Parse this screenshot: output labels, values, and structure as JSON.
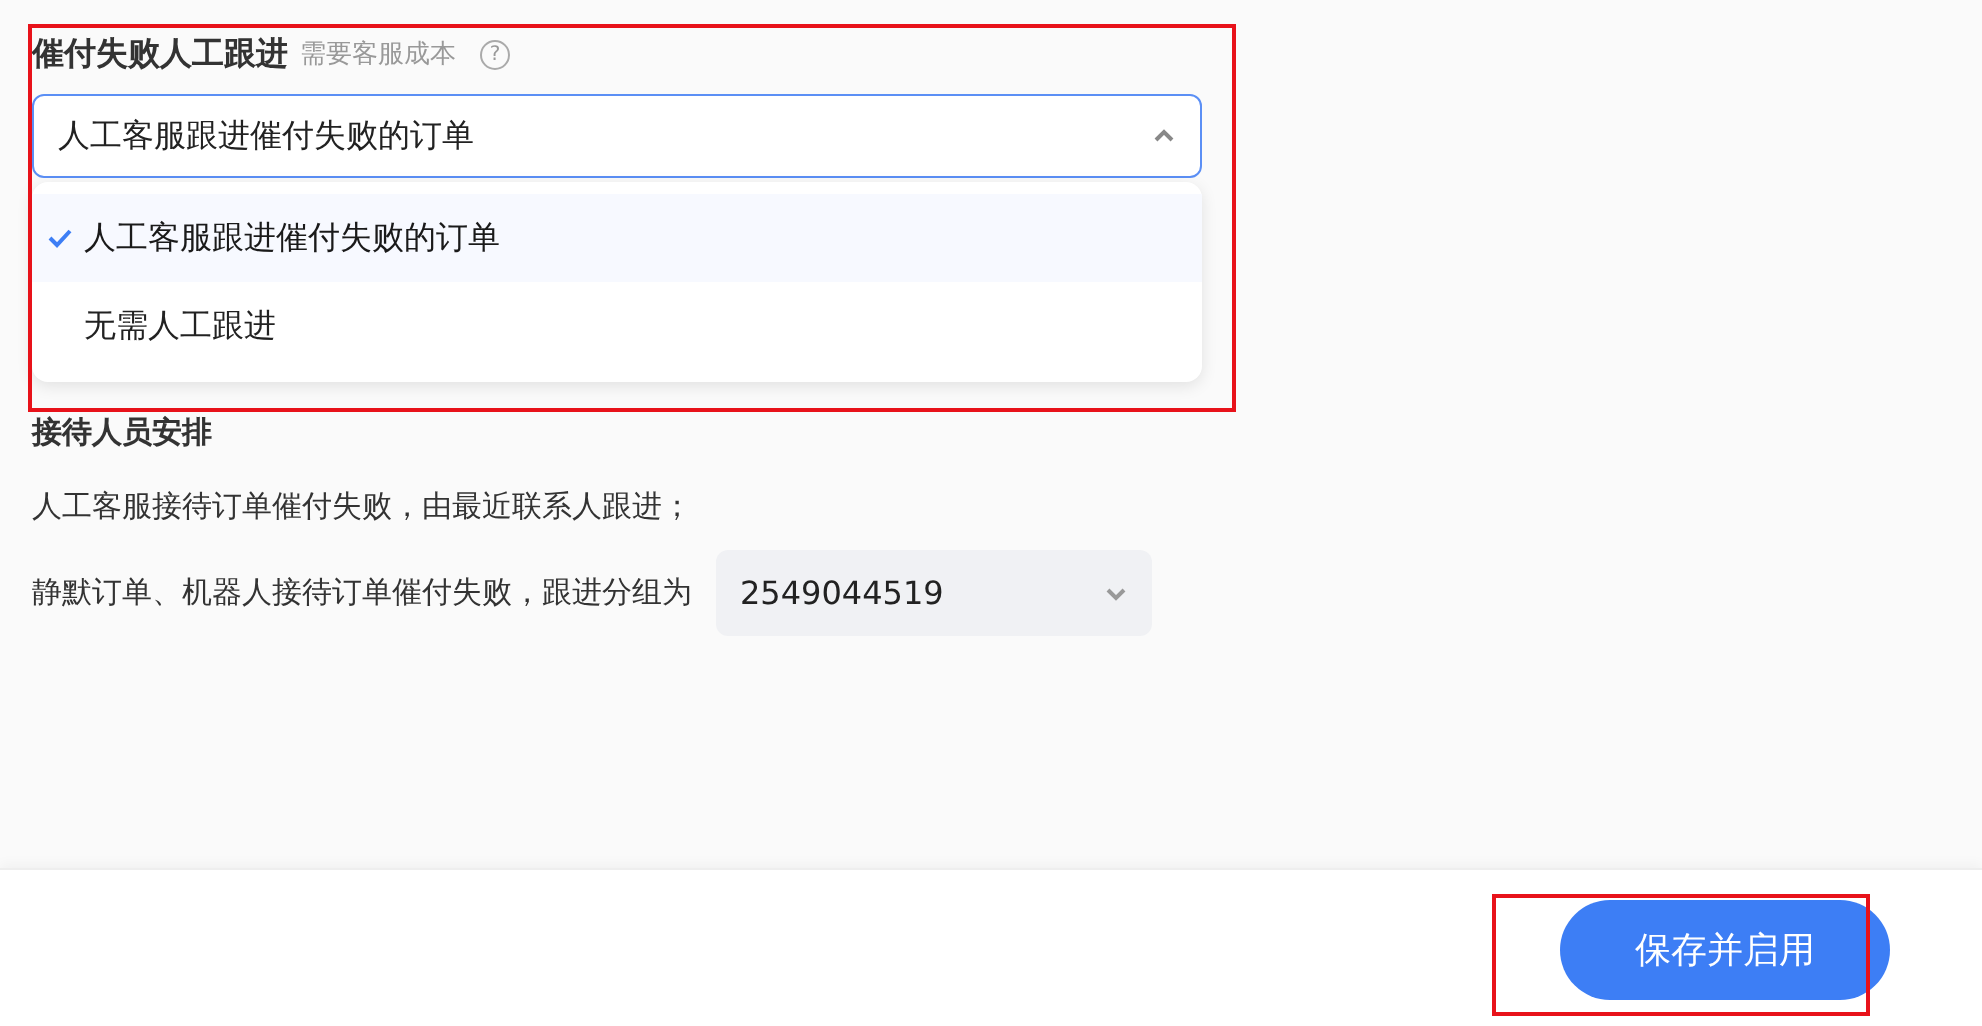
{
  "section": {
    "title": "催付失败人工跟进",
    "hint": "需要客服成本",
    "help_icon": "?"
  },
  "select": {
    "value": "人工客服跟进催付失败的订单",
    "expanded": true,
    "options": [
      {
        "label": "人工客服跟进催付失败的订单",
        "selected": true
      },
      {
        "label": "无需人工跟进",
        "selected": false
      }
    ]
  },
  "reception": {
    "title": "接待人员安排",
    "line": "人工客服接待订单催付失败，由最近联系人跟进；",
    "group_label": "静默订单、机器人接待订单催付失败，跟进分组为",
    "group_value": "2549044519"
  },
  "footer": {
    "button": "保存并启用"
  }
}
